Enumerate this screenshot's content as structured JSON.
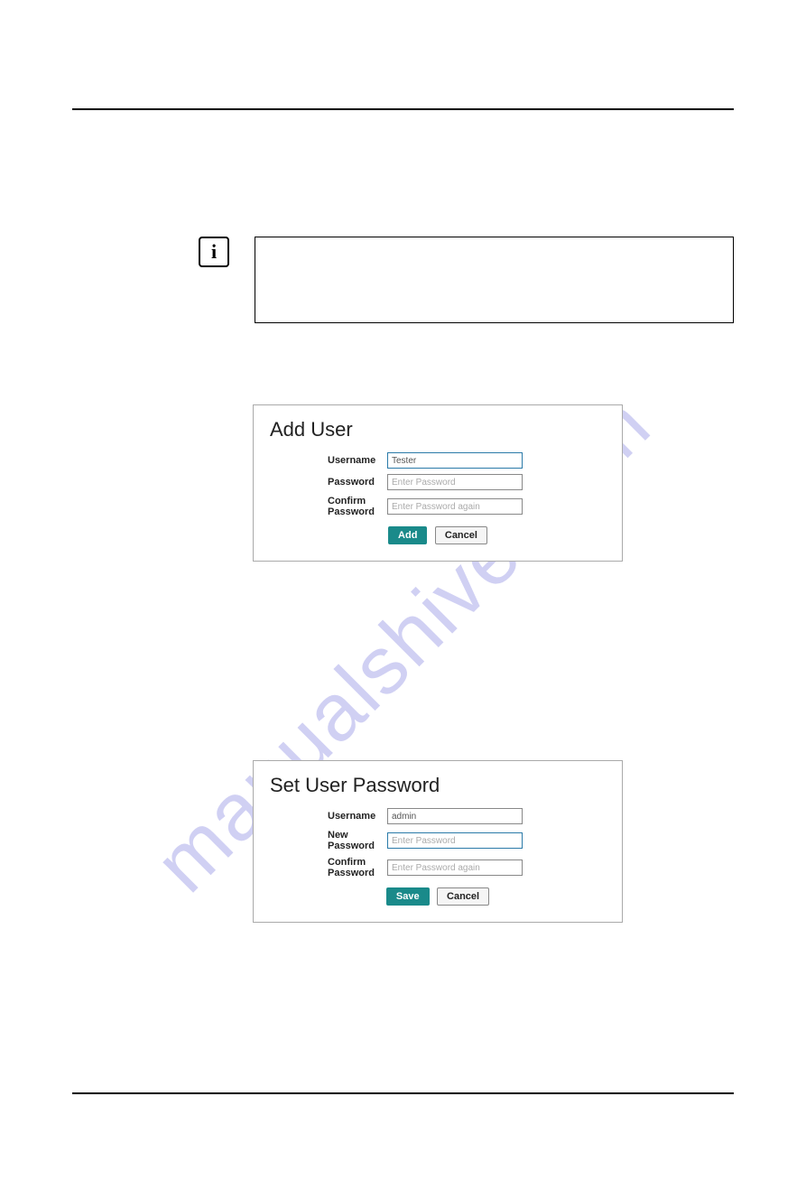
{
  "watermark": "manualshive.com",
  "info_icon": "i",
  "dialog1": {
    "title": "Add User",
    "fields": {
      "username_label": "Username",
      "username_value": "Tester",
      "password_label": "Password",
      "password_placeholder": "Enter Password",
      "confirm_label": "Confirm Password",
      "confirm_placeholder": "Enter Password again"
    },
    "buttons": {
      "primary": "Add",
      "secondary": "Cancel"
    }
  },
  "dialog2": {
    "title": "Set User Password",
    "fields": {
      "username_label": "Username",
      "username_value": "admin",
      "newpassword_label": "New Password",
      "newpassword_placeholder": "Enter Password",
      "confirm_label": "Confirm Password",
      "confirm_placeholder": "Enter Password again"
    },
    "buttons": {
      "primary": "Save",
      "secondary": "Cancel"
    }
  }
}
